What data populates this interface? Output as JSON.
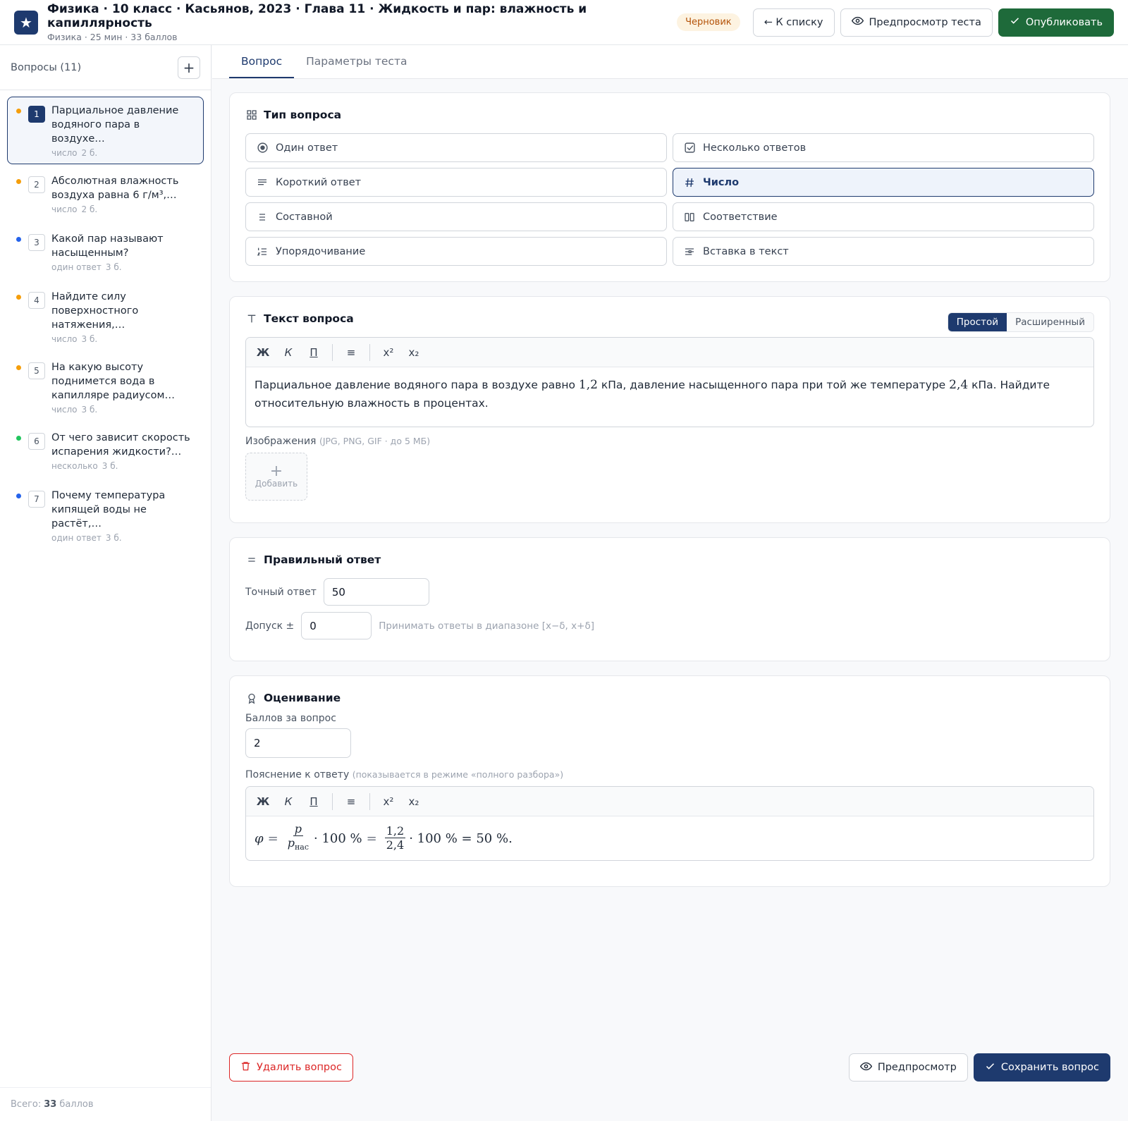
{
  "header": {
    "title": "Физика · 10 класс · Касьянов, 2023 · Глава 11 · Жидкость и пар: влажность и капиллярность",
    "subtitle": "Физика · 25 мин · 33 баллов",
    "status": "Черновик",
    "back_label": "← К списку",
    "preview_test_label": "Предпросмотр теста",
    "publish_label": "Опубликовать"
  },
  "sidebar": {
    "title": "Вопросы (11)",
    "add_symbol": "+",
    "questions": [
      {
        "num": "1",
        "text": "Парциальное давление водяного пара в воздухе…",
        "type": "число",
        "points": "2 б.",
        "dot": "#f59e0b"
      },
      {
        "num": "2",
        "text": "Абсолютная влажность воздуха равна 6 г/м³,…",
        "type": "число",
        "points": "2 б.",
        "dot": "#f59e0b"
      },
      {
        "num": "3",
        "text": "Какой пар называют насыщенным?",
        "type": "один ответ",
        "points": "3 б.",
        "dot": "#2563eb"
      },
      {
        "num": "4",
        "text": "Найдите силу поверхностного натяжения,…",
        "type": "число",
        "points": "3 б.",
        "dot": "#f59e0b"
      },
      {
        "num": "5",
        "text": "На какую высоту поднимется вода в капилляре радиусом…",
        "type": "число",
        "points": "3 б.",
        "dot": "#f59e0b"
      },
      {
        "num": "6",
        "text": "От чего зависит скорость испарения жидкости?…",
        "type": "несколько",
        "points": "3 б.",
        "dot": "#22c55e"
      },
      {
        "num": "7",
        "text": "Почему температура кипящей воды не растёт,…",
        "type": "один ответ",
        "points": "3 б.",
        "dot": "#2563eb"
      }
    ],
    "footer_prefix": "Всего:",
    "footer_total": "33",
    "footer_suffix": "баллов"
  },
  "tabs": [
    "Вопрос",
    "Параметры теста"
  ],
  "question_type": {
    "title": "Тип вопроса",
    "options": [
      {
        "label": "Один ответ",
        "icon": "radio-icon"
      },
      {
        "label": "Несколько ответов",
        "icon": "checkbox-icon"
      },
      {
        "label": "Короткий ответ",
        "icon": "text-lines-icon"
      },
      {
        "label": "Число",
        "icon": "hash-icon"
      },
      {
        "label": "Составной",
        "icon": "list-icon"
      },
      {
        "label": "Соответствие",
        "icon": "columns-icon"
      },
      {
        "label": "Упорядочивание",
        "icon": "ordered-list-icon"
      },
      {
        "label": "Вставка в текст",
        "icon": "insert-text-icon"
      }
    ],
    "selected": "Число"
  },
  "question_text": {
    "title": "Текст вопроса",
    "mode_simple": "Простой",
    "mode_advanced": "Расширенный",
    "toolbar": {
      "bold": "Ж",
      "italic": "К",
      "underline": "П",
      "list": "≡",
      "sup": "x²",
      "sub": "x₂"
    },
    "body_1": "Парциальное давление водяного пара в воздухе равно ",
    "val_1": "1,2",
    "body_2": " кПа, давление насыщенного пара при той же температуре ",
    "val_2": "2,4",
    "body_3": " кПа. Найдите относительную влажность в процентах.",
    "images_label": "Изображения",
    "images_hint": "(JPG, PNG, GIF · до 5 МБ)",
    "add_image_label": "Добавить"
  },
  "correct_answer": {
    "title": "Правильный ответ",
    "exact_label": "Точный ответ",
    "exact_value": "50",
    "tolerance_label": "Допуск ±",
    "tolerance_value": "0",
    "tolerance_hint": "Принимать ответы в диапазоне [x−δ, x+δ]"
  },
  "grading": {
    "title": "Оценивание",
    "points_label": "Баллов за вопрос",
    "points_value": "2",
    "explanation_label": "Пояснение к ответу",
    "explanation_hint": "(показывается в режиме «полного разбора»)",
    "formula": {
      "phi": "φ",
      "eq": "=",
      "p": "p",
      "p_sat": "p",
      "sat_sub": "нас",
      "times_100": "· 100 %",
      "num": "1,2",
      "den": "2,4",
      "result": "· 100 % = 50 %."
    }
  },
  "actions": {
    "delete_label": "Удалить вопрос",
    "preview_label": "Предпросмотр",
    "save_label": "Сохранить вопрос"
  }
}
